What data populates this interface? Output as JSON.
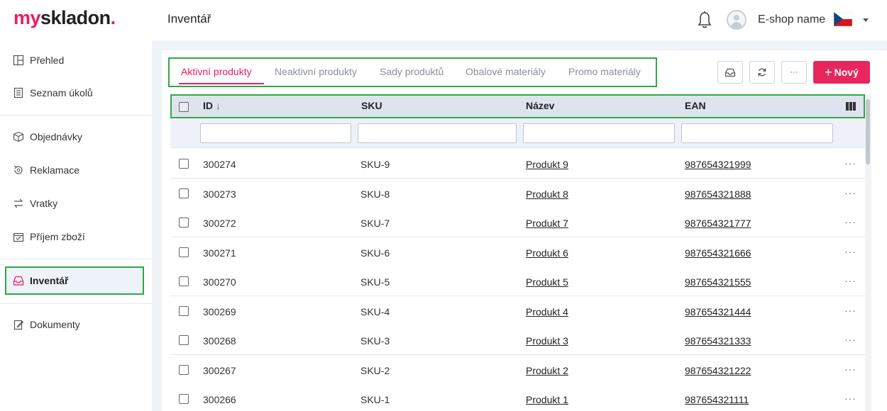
{
  "header": {
    "logo_my": "my",
    "logo_rest": "skladon",
    "logo_dot": ".",
    "page_title": "Inventář",
    "shop_name": "E-shop name"
  },
  "sidebar": {
    "items": [
      {
        "label": "Přehled",
        "icon": "dashboard-icon"
      },
      {
        "label": "Seznam úkolů",
        "icon": "task-list-icon"
      },
      {
        "label": "Objednávky",
        "icon": "box-icon"
      },
      {
        "label": "Reklamace",
        "icon": "refund-icon"
      },
      {
        "label": "Vratky",
        "icon": "return-icon"
      },
      {
        "label": "Příjem zboží",
        "icon": "receiving-icon"
      },
      {
        "label": "Inventář",
        "icon": "inbox-icon",
        "active": true
      },
      {
        "label": "Dokumenty",
        "icon": "document-icon"
      }
    ]
  },
  "tabs": [
    {
      "label": "Aktivní produkty",
      "active": true
    },
    {
      "label": "Neaktivní produkty"
    },
    {
      "label": "Sady produktů"
    },
    {
      "label": "Obalové materiály"
    },
    {
      "label": "Promo materiály"
    }
  ],
  "toolbar": {
    "more_label": "···",
    "new_label": "Nový",
    "new_plus": "+"
  },
  "table": {
    "columns": [
      "ID",
      "SKU",
      "Název",
      "EAN"
    ],
    "rows": [
      {
        "id": "300274",
        "sku": "SKU-9",
        "name": "Produkt 9",
        "ean": "987654321999"
      },
      {
        "id": "300273",
        "sku": "SKU-8",
        "name": "Produkt 8",
        "ean": "987654321888"
      },
      {
        "id": "300272",
        "sku": "SKU-7",
        "name": "Produkt 7",
        "ean": "987654321777"
      },
      {
        "id": "300271",
        "sku": "SKU-6",
        "name": "Produkt 6",
        "ean": "987654321666"
      },
      {
        "id": "300270",
        "sku": "SKU-5",
        "name": "Produkt 5",
        "ean": "987654321555"
      },
      {
        "id": "300269",
        "sku": "SKU-4",
        "name": "Produkt 4",
        "ean": "987654321444"
      },
      {
        "id": "300268",
        "sku": "SKU-3",
        "name": "Produkt 3",
        "ean": "987654321333"
      },
      {
        "id": "300267",
        "sku": "SKU-2",
        "name": "Produkt 2",
        "ean": "987654321222"
      },
      {
        "id": "300266",
        "sku": "SKU-1",
        "name": "Produkt 1",
        "ean": "987654321111"
      }
    ],
    "row_menu": "···"
  },
  "colors": {
    "accent": "#e91e63",
    "highlight_border": "#2eaa45",
    "header_bg": "#dfe3ee"
  }
}
